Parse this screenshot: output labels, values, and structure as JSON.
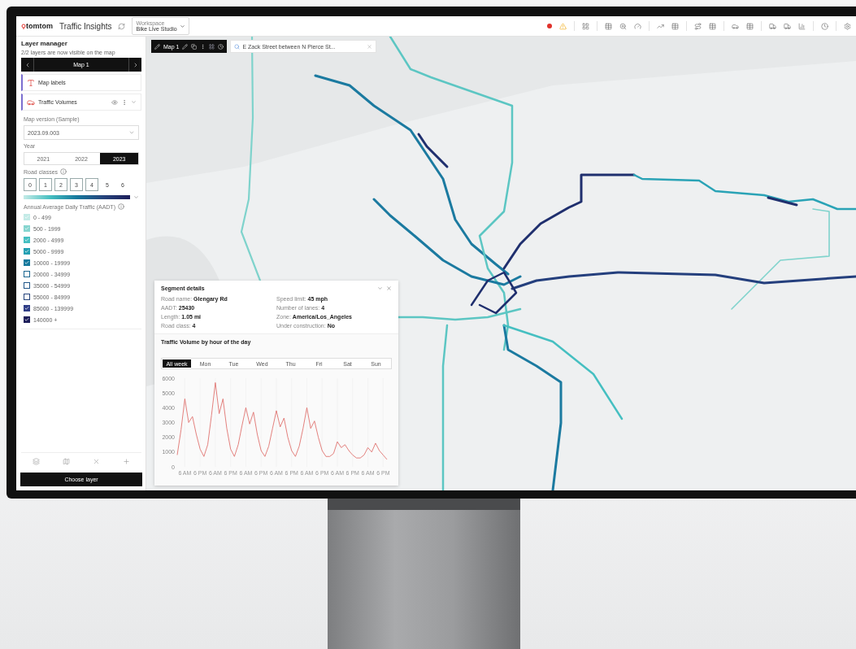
{
  "header": {
    "brand": "tomtom",
    "product": "Traffic Insights",
    "workspace": {
      "label": "Workspace",
      "value": "Bike Live Studio"
    }
  },
  "sidebar": {
    "title": "Layer manager",
    "subtitle": "2/2 layers are now visible on the map",
    "map_nav": {
      "label": "Map 1"
    },
    "layers": [
      {
        "name": "Map labels",
        "kind": "labels"
      },
      {
        "name": "Traffic Volumes",
        "kind": "traffic"
      }
    ],
    "map_version": {
      "label": "Map version (Sample)",
      "value": "2023.09.003"
    },
    "year": {
      "label": "Year",
      "options": [
        {
          "label": "2021",
          "selected": false
        },
        {
          "label": "2022",
          "selected": false
        },
        {
          "label": "2023",
          "selected": true
        }
      ]
    },
    "road_classes": {
      "label": "Road classes",
      "options": [
        {
          "label": "0",
          "selected": true
        },
        {
          "label": "1",
          "selected": true
        },
        {
          "label": "2",
          "selected": true
        },
        {
          "label": "3",
          "selected": true
        },
        {
          "label": "4",
          "selected": true
        },
        {
          "label": "5",
          "selected": false
        },
        {
          "label": "6",
          "selected": false
        }
      ]
    },
    "aadt": {
      "label": "Annual Average Daily Traffic (AADT)",
      "bands": [
        {
          "label": "0 - 499",
          "checked": true,
          "color": "#c4ebe7"
        },
        {
          "label": "500 - 1999",
          "checked": true,
          "color": "#86d5cf"
        },
        {
          "label": "2000 - 4999",
          "checked": true,
          "color": "#45bfc1"
        },
        {
          "label": "5000 - 9999",
          "checked": true,
          "color": "#229fb2"
        },
        {
          "label": "10000 - 19999",
          "checked": true,
          "color": "#16799d"
        },
        {
          "label": "20000 - 34999",
          "checked": false,
          "color": "#1b6791"
        },
        {
          "label": "35000 - 54999",
          "checked": false,
          "color": "#1f5588"
        },
        {
          "label": "55000 - 84999",
          "checked": false,
          "color": "#26447c"
        },
        {
          "label": "85000 - 139999",
          "checked": true,
          "color": "#2f3d86"
        },
        {
          "label": "140000 +",
          "checked": true,
          "color": "#1d1e5a"
        }
      ]
    },
    "choose_layer": "Choose layer"
  },
  "map_toolbar": {
    "map_label": "Map 1",
    "search_value": "E Zack Street between N Pierce St..."
  },
  "segment": {
    "title": "Segment details",
    "fields": [
      {
        "label": "Road name:",
        "value": "Glengary Rd"
      },
      {
        "label": "Speed limit:",
        "value": "45 mph"
      },
      {
        "label": "AADT:",
        "value": "25430"
      },
      {
        "label": "Number of lanes:",
        "value": "4"
      },
      {
        "label": "Length:",
        "value": "1.05 mi"
      },
      {
        "label": "Zone:",
        "value": "America/Los_Angeles"
      },
      {
        "label": "Road class:",
        "value": "4"
      },
      {
        "label": "Under construction:",
        "value": "No"
      }
    ],
    "chart_title": "Traffic Volume by hour of the day",
    "tabs": [
      {
        "label": "All week",
        "selected": true
      },
      {
        "label": "Mon",
        "selected": false
      },
      {
        "label": "Tue",
        "selected": false
      },
      {
        "label": "Wed",
        "selected": false
      },
      {
        "label": "Thu",
        "selected": false
      },
      {
        "label": "Fri",
        "selected": false
      },
      {
        "label": "Sat",
        "selected": false
      },
      {
        "label": "Sun",
        "selected": false
      }
    ],
    "chart_data": {
      "type": "line",
      "categories": [
        null,
        null,
        "6 AM",
        null,
        null,
        null,
        "6 PM",
        null,
        null,
        null,
        "6 AM",
        null,
        null,
        null,
        "6 PM",
        null,
        null,
        null,
        "6 AM",
        null,
        null,
        null,
        "6 PM",
        null,
        null,
        null,
        "6 AM",
        null,
        null,
        null,
        "6 PM",
        null,
        null,
        null,
        "6 AM",
        null,
        null,
        null,
        "6 PM",
        null,
        null,
        null,
        "6 AM",
        null,
        null,
        null,
        "6 PM",
        null,
        null,
        null,
        "6 AM",
        null,
        null,
        null,
        "6 PM",
        null
      ],
      "grid": true,
      "ylim": [
        0,
        6000
      ],
      "yticks": [
        0,
        1000,
        2000,
        3000,
        4000,
        5000,
        6000
      ],
      "series": [
        {
          "color": "#e0736f",
          "values": [
            800,
            2500,
            4600,
            3000,
            3400,
            2200,
            1200,
            700,
            1500,
            3500,
            5700,
            3600,
            4600,
            2600,
            1200,
            700,
            1500,
            2800,
            4000,
            2900,
            3700,
            2200,
            1100,
            700,
            1400,
            2600,
            3800,
            2700,
            3300,
            2000,
            1100,
            700,
            1400,
            2600,
            4000,
            2600,
            3100,
            2000,
            1100,
            700,
            700,
            900,
            1700,
            1300,
            1500,
            1100,
            800,
            600,
            600,
            800,
            1300,
            1000,
            1600,
            1100,
            800,
            500
          ]
        }
      ]
    }
  }
}
